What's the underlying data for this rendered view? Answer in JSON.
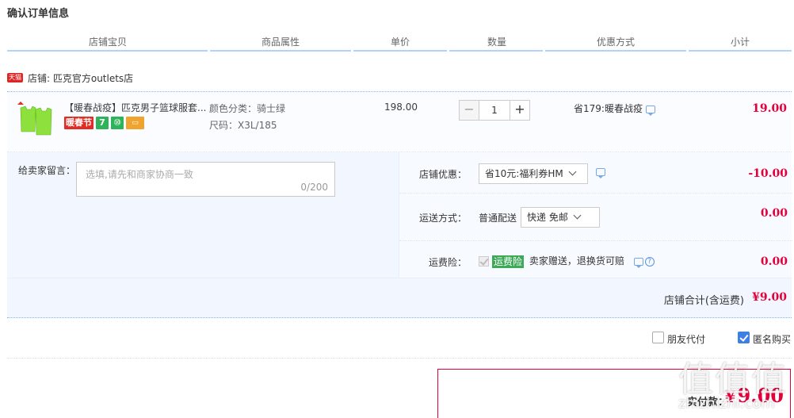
{
  "page_title": "确认订单信息",
  "columns": [
    "店铺宝贝",
    "商品属性",
    "单价",
    "数量",
    "优惠方式",
    "小计"
  ],
  "shop": {
    "badge": "天猫",
    "label": "店铺: 匹克官方outlets店"
  },
  "item": {
    "title": "【暖春战疫】匹克男子篮球服套...",
    "tags": [
      "暖春节",
      "7",
      "⑩",
      "▭"
    ],
    "attr_color": "颜色分类：骑士绿",
    "attr_size": "尺码：X3L/185",
    "price": "198.00",
    "quantity": "1",
    "discount": "省179:暖春战疫",
    "subtotal": "19.00"
  },
  "message": {
    "label": "给卖家留言：",
    "placeholder": "选填,请先和商家协商一致",
    "count": "0/200"
  },
  "shop_discount": {
    "label": "店铺优惠：",
    "selected": "省10元:福利券HM",
    "amount": "-10.00"
  },
  "shipping": {
    "label": "运送方式：",
    "method": "普通配送",
    "selected": "快递 免邮",
    "amount": "0.00"
  },
  "insurance": {
    "label": "运费险：",
    "badge": "运费险",
    "text": "卖家赠送，退换货可赔",
    "amount": "0.00"
  },
  "shop_total": {
    "label": "店铺合计(含运费)",
    "value": "¥9.00"
  },
  "options": {
    "friend_pay": "朋友代付",
    "anonymous": "匿名购买"
  },
  "payment": {
    "label": "实付款：",
    "currency": "¥",
    "value": "9.00"
  },
  "watermark": {
    "chars": "值值值",
    "url": "zhizhizhi.com"
  },
  "colors": {
    "accent_red": "#e4003a",
    "brand_blue": "#3d7fe3",
    "tmall_red": "#dd2727"
  }
}
